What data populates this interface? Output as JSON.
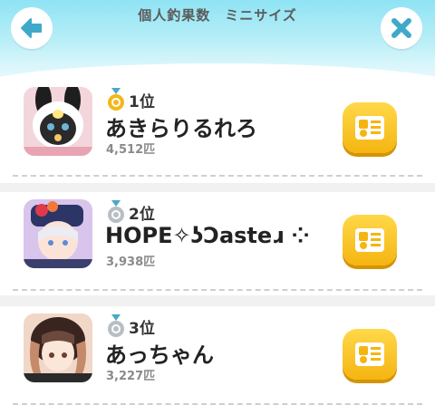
{
  "header": {
    "title": "個人釣果数　ミニサイズ",
    "back_icon": "back-arrow-icon",
    "close_icon": "close-x-icon",
    "accent_color": "#3fa9c9"
  },
  "ranking": [
    {
      "rank_label": "1位",
      "medal": "gold",
      "name": "あきらりるれろ",
      "weight": "4,512匹"
    },
    {
      "rank_label": "2位",
      "medal": "silver",
      "name": "HOPE✧ʖƆasteɹ ⁘",
      "weight": "3,938匹"
    },
    {
      "rank_label": "3位",
      "medal": "silver",
      "name": "あっちゃん",
      "weight": "3,227匹"
    }
  ],
  "colors": {
    "gold_medal": "#f2b81c",
    "silver_medal": "#b8bec4",
    "profile_button": "#f5b511"
  }
}
